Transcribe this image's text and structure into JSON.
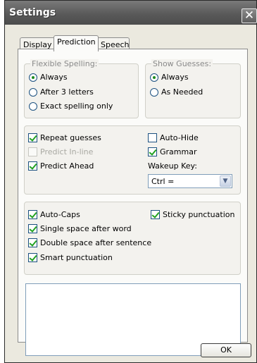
{
  "window": {
    "title": "Settings",
    "close_symbol": "✕"
  },
  "tabs": [
    {
      "label": "Display",
      "active": false
    },
    {
      "label": "Prediction",
      "active": true
    },
    {
      "label": "Speech",
      "active": false
    }
  ],
  "flexible_spelling": {
    "legend": "Flexible Spelling:",
    "options": [
      {
        "label": "Always",
        "selected": true
      },
      {
        "label": "After 3 letters",
        "selected": false
      },
      {
        "label": "Exact spelling only",
        "selected": false
      }
    ]
  },
  "show_guesses": {
    "legend": "Show Guesses:",
    "options": [
      {
        "label": "Always",
        "selected": true
      },
      {
        "label": "As Needed",
        "selected": false
      }
    ]
  },
  "prediction_options": {
    "repeat_guesses": {
      "label": "Repeat guesses",
      "checked": true
    },
    "predict_inline": {
      "label": "Predict In-line",
      "checked": false,
      "enabled": false
    },
    "predict_ahead": {
      "label": "Predict Ahead",
      "checked": true
    },
    "auto_hide": {
      "label": "Auto-Hide",
      "checked": false
    },
    "grammar": {
      "label": "Grammar",
      "checked": true
    },
    "wakeup_key": {
      "label": "Wakeup Key:",
      "value": "Ctrl ="
    }
  },
  "text_options": {
    "auto_caps": {
      "label": "Auto-Caps",
      "checked": true
    },
    "sticky_punctuation": {
      "label": "Sticky punctuation",
      "checked": true
    },
    "single_space": {
      "label": "Single space after word",
      "checked": true
    },
    "double_space": {
      "label": "Double space after sentence",
      "checked": true
    },
    "smart_punctuation": {
      "label": "Smart punctuation",
      "checked": true
    }
  },
  "buttons": {
    "ok_label": "OK"
  },
  "icons": {
    "close": "close-icon",
    "dropdown": "chevron-down-icon"
  }
}
